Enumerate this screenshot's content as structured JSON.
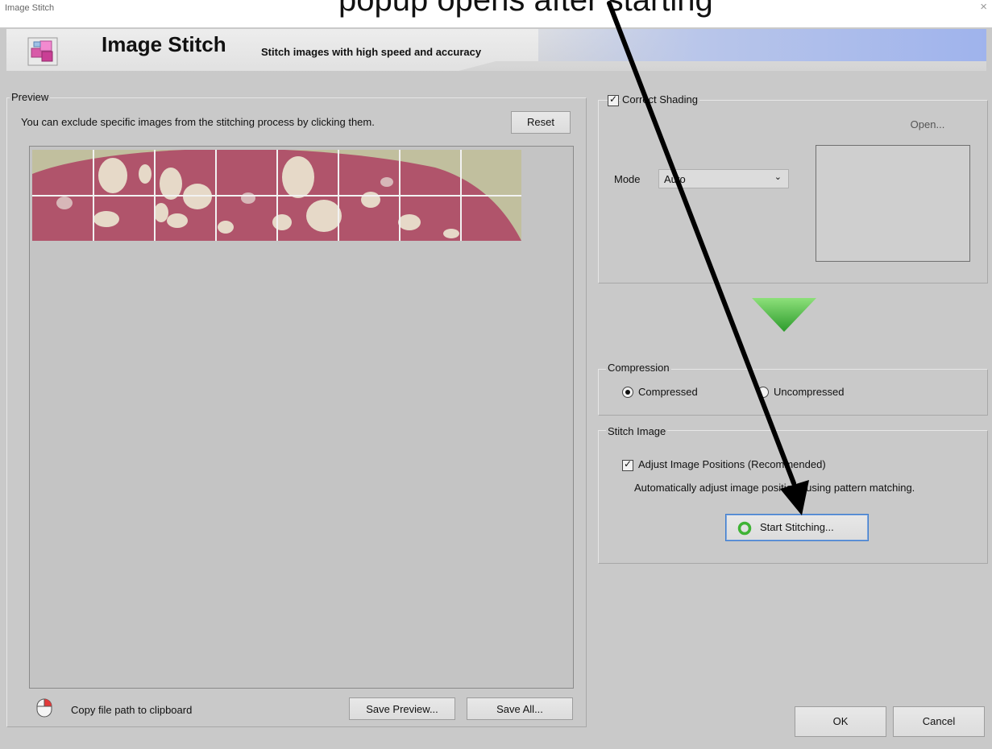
{
  "window": {
    "title": "Image Stitch",
    "close_glyph": "×",
    "overflow_text": "popup opens after starting"
  },
  "banner": {
    "title": "Image Stitch",
    "subtitle": "Stitch images with high speed and accuracy",
    "logo_icon": "image-stitch-logo-icon"
  },
  "preview": {
    "group_label": "Preview",
    "instruction": "You can exclude specific images from the stitching process by clicking them.",
    "reset_label": "Reset",
    "tile_rows": 2,
    "tile_cols": 8,
    "tissue_color": "#b0546b",
    "background_tile_color": "#c1bf9e"
  },
  "footer_left": {
    "clipboard_icon": "mouse-icon",
    "clipboard_label": "Copy file path to clipboard",
    "save_preview_label": "Save Preview...",
    "save_all_label": "Save All..."
  },
  "shading": {
    "checkbox_label": "Correct Shading",
    "checked": true,
    "open_label": "Open...",
    "mode_label": "Mode",
    "mode_value": "Auto"
  },
  "flow_arrow_icon": "green-triangle-down-icon",
  "compression": {
    "group_label": "Compression",
    "options": [
      "Compressed",
      "Uncompressed"
    ],
    "selected": "Compressed"
  },
  "stitch": {
    "group_label": "Stitch Image",
    "adjust_label": "Adjust Image Positions (Recommended)",
    "adjust_checked": true,
    "description": "Automatically adjust image positions using pattern matching.",
    "start_label": "Start Stitching...",
    "start_icon": "green-ring-icon"
  },
  "dialog_buttons": {
    "ok_label": "OK",
    "cancel_label": "Cancel"
  },
  "annotation_arrow_color": "#000000",
  "accent_green": "#3fb335"
}
